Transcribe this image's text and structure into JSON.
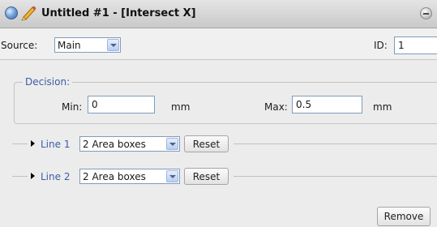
{
  "window": {
    "title": "Untitled #1 - [Intersect X]"
  },
  "source": {
    "label": "Source:",
    "selected": "Main"
  },
  "id": {
    "label": "ID:",
    "value": "1"
  },
  "decision": {
    "legend": "Decision:",
    "min_label": "Min:",
    "min_value": "0",
    "min_unit": "mm",
    "max_label": "Max:",
    "max_value": "0.5",
    "max_unit": "mm"
  },
  "lines": [
    {
      "label": "Line 1",
      "selected": "2 Area boxes",
      "reset_label": "Reset"
    },
    {
      "label": "Line 2",
      "selected": "2 Area boxes",
      "reset_label": "Reset"
    }
  ],
  "actions": {
    "remove_label": "Remove"
  },
  "icons": {
    "app": "circle-app-icon",
    "edit": "pencil-icon",
    "minimize": "minimize-icon",
    "expand": "triangle-right-icon",
    "dropdown": "chevron-down-icon"
  },
  "colors": {
    "accent_text": "#3b5ea8",
    "titlebar": "#d6d6d6",
    "panel_bg": "#ececec"
  }
}
